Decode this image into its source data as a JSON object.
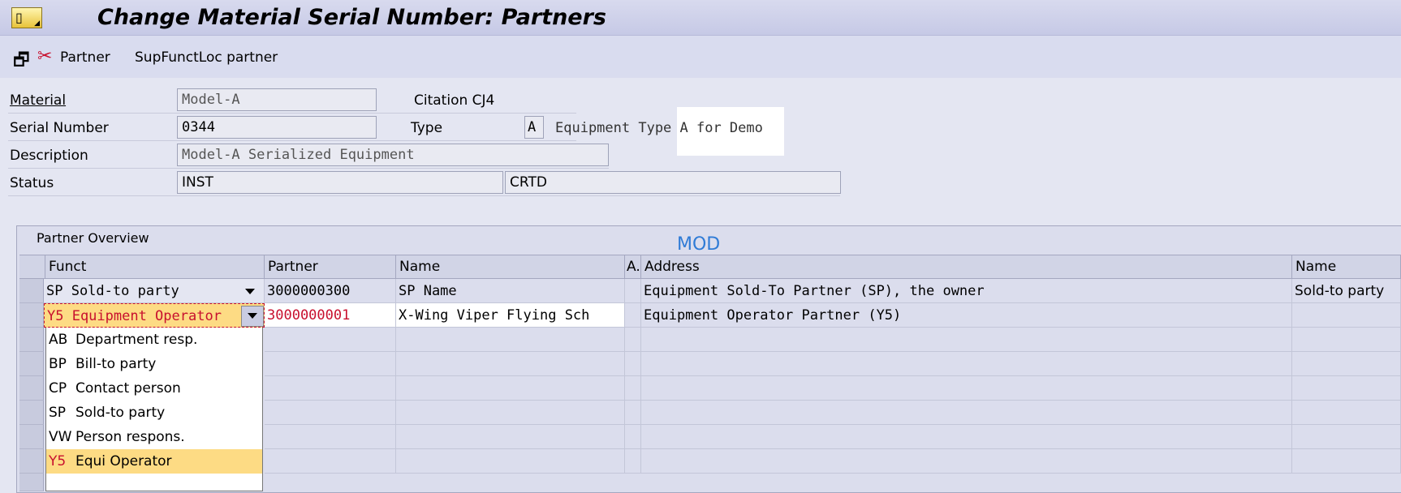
{
  "window": {
    "title": "Change Material Serial Number: Partners"
  },
  "toolbar": {
    "items": [
      {
        "label": "Partner",
        "icon": "partner-icon"
      },
      {
        "label": "SupFunctLoc partner"
      }
    ]
  },
  "header": {
    "material": {
      "label": "Material",
      "value": "Model-A"
    },
    "citation": "Citation CJ4",
    "serial": {
      "label": "Serial Number",
      "value": "0344"
    },
    "type": {
      "label": "Type",
      "code": "A",
      "text": "Equipment Type A for Demo"
    },
    "description": {
      "label": "Description",
      "value": "Model-A Serialized Equipment"
    },
    "status": {
      "label": "Status",
      "value1": "INST",
      "value2": "CRTD"
    }
  },
  "partner_table": {
    "title": "Partner Overview",
    "mod_label": "MOD",
    "columns": [
      "Funct",
      "Partner",
      "Name",
      "A.",
      "Address",
      "Name"
    ],
    "rows": [
      {
        "funct": "SP Sold-to party",
        "partner": "3000000300",
        "name": "SP Name",
        "a": "",
        "address": "Equipment Sold-To Partner (SP), the owner",
        "name2": "Sold-to party"
      },
      {
        "funct": "Y5 Equipment Operator",
        "partner": "3000000001",
        "name": "X-Wing Viper Flying Sch",
        "a": "",
        "address": "Equipment Operator Partner (Y5)",
        "name2": ""
      }
    ]
  },
  "dropdown": {
    "options": [
      {
        "code": "AB",
        "text": "Department resp."
      },
      {
        "code": "BP",
        "text": "Bill-to party"
      },
      {
        "code": "CP",
        "text": "Contact person"
      },
      {
        "code": "SP",
        "text": "Sold-to party"
      },
      {
        "code": "VW",
        "text": "Person respons."
      },
      {
        "code": "Y5",
        "text": "Equi  Operator"
      }
    ],
    "selected_index": 5
  },
  "colors": {
    "title_bar": "#c6c9e6",
    "toolbar": "#d9dcef",
    "active_row_text": "#c8102e",
    "highlight": "#fddb84",
    "mod_text": "#2f7bd6"
  }
}
